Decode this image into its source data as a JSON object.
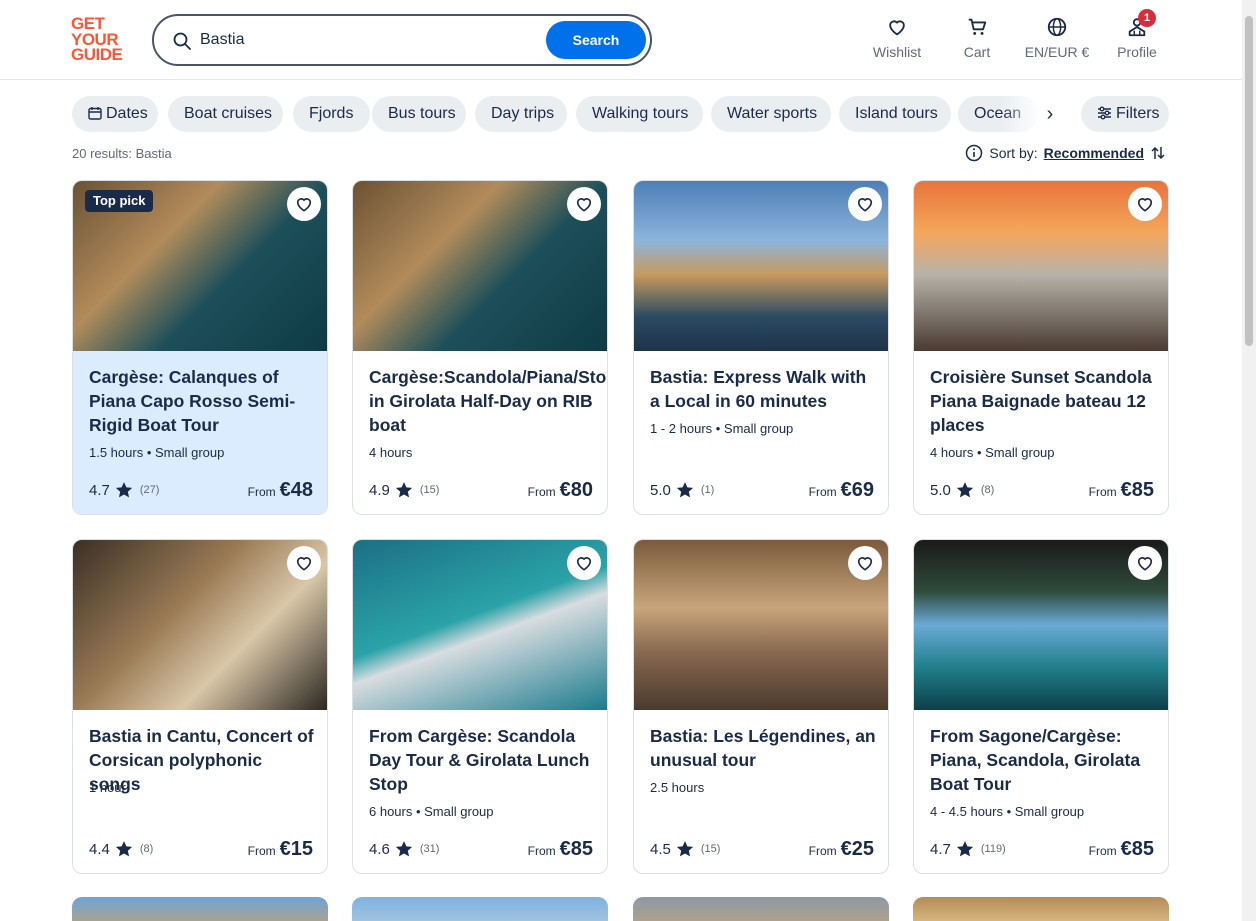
{
  "brand": {
    "logo_line1": "GET",
    "logo_line2": "YOUR",
    "logo_line3": "GUIDE",
    "color": "#ff5533"
  },
  "search": {
    "value": "Bastia",
    "button_label": "Search",
    "button_color": "#0071eb"
  },
  "nav": {
    "wishlist": "Wishlist",
    "cart": "Cart",
    "language": "EN/EUR €",
    "profile": "Profile",
    "profile_badge": "1"
  },
  "chips": [
    "Dates",
    "Boat cruises",
    "Fjords",
    "Bus tours",
    "Day trips",
    "Walking tours",
    "Water sports",
    "Island tours",
    "Ocean"
  ],
  "filters_label": "Filters",
  "results_text": "20 results: Bastia",
  "sort": {
    "label": "Sort by:",
    "value": "Recommended"
  },
  "cards": [
    {
      "title": "Cargèse: Calanques of Piana Capo Rosso Semi-Rigid Boat Tour",
      "meta": "1.5 hours • Small group",
      "rating": "4.7",
      "count": "(27)",
      "from": "From",
      "price": "€48",
      "badge": "Top pick"
    },
    {
      "title": "Cargèse:Scandola/Piana/Stop in Girolata Half-Day on RIB boat",
      "meta": "4 hours",
      "rating": "4.9",
      "count": "(15)",
      "from": "From",
      "price": "€80"
    },
    {
      "title": "Bastia: Express Walk with a Local in 60 minutes",
      "meta": "1 - 2 hours • Small group",
      "rating": "5.0",
      "count": "(1)",
      "from": "From",
      "price": "€69"
    },
    {
      "title": "Croisière Sunset Scandola Piana Baignade bateau 12 places",
      "meta": "4 hours • Small group",
      "rating": "5.0",
      "count": "(8)",
      "from": "From",
      "price": "€85"
    },
    {
      "title": "Bastia in Cantu, Concert of Corsican polyphonic songs",
      "meta": "1 hour",
      "rating": "4.4",
      "count": "(8)",
      "from": "From",
      "price": "€15"
    },
    {
      "title": "From Cargèse: Scandola Day Tour & Girolata Lunch Stop",
      "meta": "6 hours • Small group",
      "rating": "4.6",
      "count": "(31)",
      "from": "From",
      "price": "€85"
    },
    {
      "title": "Bastia: Les Légendines, an unusual tour",
      "meta": "2.5 hours",
      "rating": "4.5",
      "count": "(15)",
      "from": "From",
      "price": "€25"
    },
    {
      "title": "From Sagone/Cargèse: Piana, Scandola, Girolata Boat Tour",
      "meta": "4 - 4.5 hours • Small group",
      "rating": "4.7",
      "count": "(119)",
      "from": "From",
      "price": "€85"
    }
  ]
}
